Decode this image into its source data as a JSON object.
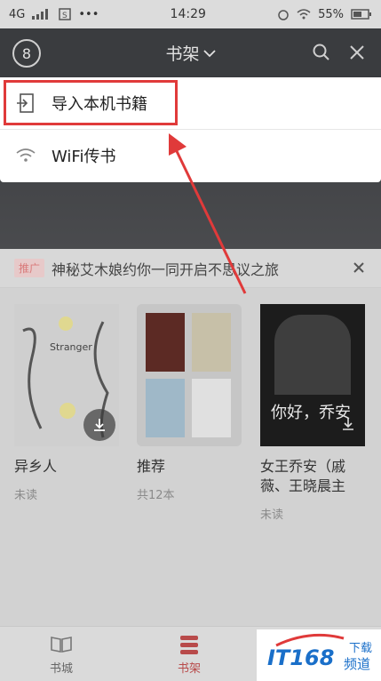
{
  "status_bar": {
    "network": "4G",
    "time": "14:29",
    "battery": "55%"
  },
  "header": {
    "title": "书架",
    "avatar_glyph": "8"
  },
  "dropdown": {
    "items": [
      {
        "label": "导入本机书籍",
        "icon": "import-book-icon"
      },
      {
        "label": "WiFi传书",
        "icon": "wifi-icon"
      }
    ]
  },
  "promo": {
    "badge": "推广",
    "text": "神秘艾木娘约你一同开启不思议之旅"
  },
  "books": [
    {
      "title": "异乡人",
      "sub": "未读",
      "cover_text": "Stranger"
    },
    {
      "title": "推荐",
      "sub": "共12本"
    },
    {
      "title": "女王乔安（戚薇、王晓晨主",
      "sub": "未读",
      "cover_text": "你好，乔安"
    }
  ],
  "tabs": [
    {
      "label": "书城"
    },
    {
      "label": "书架"
    }
  ],
  "watermark": {
    "brand": "IT168",
    "sub1": "下载",
    "sub2": "频道"
  },
  "colors": {
    "highlight": "#e03a3a",
    "header_bg": "#3a3c3f",
    "tab_active": "#b84a4a"
  }
}
